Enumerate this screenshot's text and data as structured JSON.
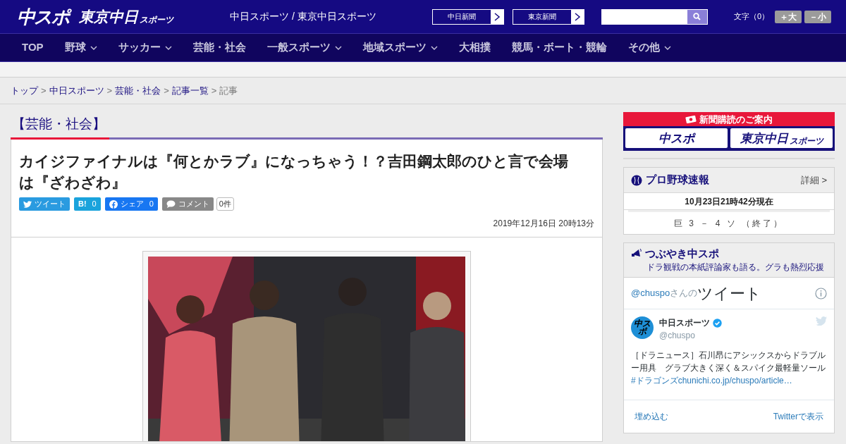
{
  "header": {
    "logo_main": "中スポ",
    "logo_tokyo": "東京中日",
    "logo_tokyo_small": "スポーツ",
    "site_title": "中日スポーツ / 東京中日スポーツ",
    "paper_links": [
      "中日新聞",
      "東京新聞"
    ],
    "font_size_label": "文字（0）",
    "font_buttons": [
      "＋大",
      "－小"
    ]
  },
  "nav": [
    {
      "label": "TOP",
      "dropdown": false
    },
    {
      "label": "野球",
      "dropdown": true
    },
    {
      "label": "サッカー",
      "dropdown": true
    },
    {
      "label": "芸能・社会",
      "dropdown": false
    },
    {
      "label": "一般スポーツ",
      "dropdown": true
    },
    {
      "label": "地域スポーツ",
      "dropdown": true
    },
    {
      "label": "大相撲",
      "dropdown": false
    },
    {
      "label": "競馬・ボート・競輪",
      "dropdown": false
    },
    {
      "label": "その他",
      "dropdown": true
    }
  ],
  "breadcrumb": [
    {
      "label": "トップ",
      "kind": "link"
    },
    {
      "label": ">",
      "kind": "separator"
    },
    {
      "label": "中日スポーツ",
      "kind": "link"
    },
    {
      "label": ">",
      "kind": "separator"
    },
    {
      "label": "芸能・社会",
      "kind": "link"
    },
    {
      "label": ">",
      "kind": "separator"
    },
    {
      "label": "記事一覧",
      "kind": "link"
    },
    {
      "label": ">",
      "kind": "separator"
    },
    {
      "label": "記事",
      "kind": "current"
    }
  ],
  "category": "【芸能・社会】",
  "article": {
    "title": "カイジファイナルは『何とかラブ』になっちゃう！？吉田鋼太郎のひと言で会場は『ざわざわ』",
    "share": [
      {
        "kind": "twitter",
        "label": "ツイート"
      },
      {
        "kind": "hatena",
        "label": "B!",
        "count": "0"
      },
      {
        "kind": "facebook",
        "label": "シェア",
        "count": "0"
      },
      {
        "kind": "comment",
        "label": "コメント",
        "count": "0件"
      }
    ],
    "date": "2019年12月16日 20時13分"
  },
  "sidebar": {
    "subscribe": {
      "title": "新聞購読のご案内",
      "logos": [
        "中スポ",
        "東京中日"
      ],
      "logo_small": "スポーツ"
    },
    "baseball": {
      "title": "プロ野球速報",
      "detail_link": "詳細 >",
      "updated": "10月23日21時42分現在",
      "score": "巨 3 － 4 ソ （終了）"
    },
    "tweets": {
      "title": "つぶやき中スポ",
      "subtitle": "ドラ観戦の本紙評論家も語る。グラも熱烈応援",
      "handle_prefix": "@chuspo",
      "handle_suffix": "さんの",
      "heading": "ツイート",
      "account_name": "中日スポーツ",
      "account_handle": "@chuspo",
      "avatar_text": "中スポ",
      "verified": true,
      "tweet_text": "［ドラニュース］石川昂にアシックスからドラブルー用具　グラブ大きく深く＆スパイク最軽量ソール",
      "tweet_link": "#ドラゴンズchunichi.co.jp/chuspo/article…",
      "footer_links": [
        "埋め込む",
        "Twitterで表示"
      ]
    }
  }
}
